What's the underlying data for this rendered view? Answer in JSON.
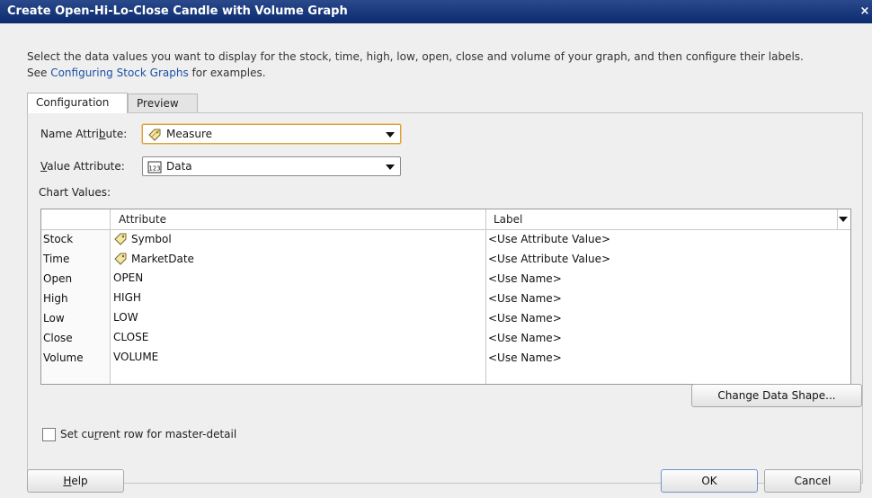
{
  "window": {
    "title": "Create Open-Hi-Lo-Close Candle with Volume Graph",
    "close_glyph": "×"
  },
  "instructions": {
    "line1": "Select the data values you want to display for the stock, time, high, low, open, close and volume of your graph, and then configure their labels.",
    "line2_prefix": "See ",
    "link": "Configuring Stock Graphs",
    "line2_suffix": " for examples."
  },
  "tabs": [
    {
      "label": "Configuration",
      "active": true
    },
    {
      "label": "Preview",
      "active": false
    }
  ],
  "name_attribute": {
    "label_pre": "Name Attri",
    "label_mnemonic": "b",
    "label_post": "ute:",
    "value": "Measure",
    "icon": "tag-icon"
  },
  "value_attribute": {
    "label_mnemonic": "V",
    "label_post": "alue Attribute:",
    "value": "Data",
    "icon": "numeric-123-icon"
  },
  "chart_values": {
    "label": "Chart Values:",
    "columns": [
      "Attribute",
      "Label"
    ],
    "rows": [
      {
        "name": "Stock",
        "attribute": "Symbol",
        "label": "<Use Attribute Value>",
        "icon": "tag-icon"
      },
      {
        "name": "Time",
        "attribute": "MarketDate",
        "label": "<Use Attribute Value>",
        "icon": "tag-icon"
      },
      {
        "name": "Open",
        "attribute": "OPEN",
        "label": "<Use Name>",
        "icon": ""
      },
      {
        "name": "High",
        "attribute": "HIGH",
        "label": "<Use Name>",
        "icon": ""
      },
      {
        "name": "Low",
        "attribute": "LOW",
        "label": "<Use Name>",
        "icon": ""
      },
      {
        "name": "Close",
        "attribute": "CLOSE",
        "label": "<Use Name>",
        "icon": ""
      },
      {
        "name": "Volume",
        "attribute": "VOLUME",
        "label": "<Use Name>",
        "icon": ""
      }
    ]
  },
  "change_data_shape_label": "Change Data Shape...",
  "master_detail": {
    "pre": "Set cu",
    "mnemonic": "r",
    "post": "rent row for master-detail",
    "checked": false
  },
  "buttons": {
    "help_mnemonic": "H",
    "help_post": "elp",
    "ok": "OK",
    "cancel": "Cancel"
  },
  "colors": {
    "title_bar": "#0c2a6e",
    "link": "#1c4fa8",
    "focus": "#d7a24a"
  }
}
